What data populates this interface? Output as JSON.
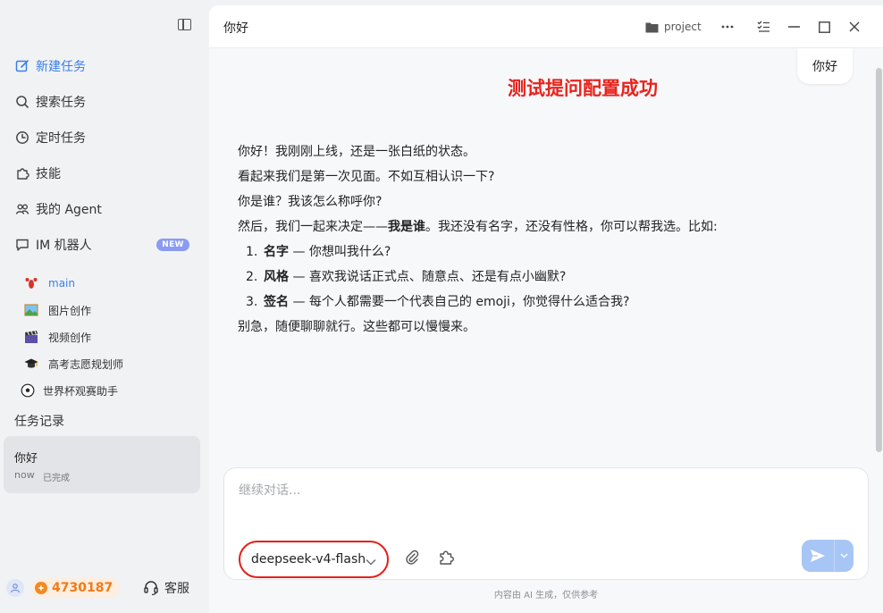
{
  "sidebar": {
    "nav": [
      {
        "label": "新建任务",
        "icon": "new-task-icon",
        "active": true
      },
      {
        "label": "搜索任务",
        "icon": "search-icon"
      },
      {
        "label": "定时任务",
        "icon": "clock-icon"
      },
      {
        "label": "技能",
        "icon": "puzzle-icon"
      },
      {
        "label": "我的 Agent",
        "icon": "agent-icon"
      },
      {
        "label": "IM 机器人",
        "icon": "chat-icon",
        "badge": "NEW"
      }
    ],
    "agents": [
      {
        "label": "main",
        "icon": "lobster-icon"
      },
      {
        "label": "图片创作",
        "icon": "picture-icon"
      },
      {
        "label": "视频创作",
        "icon": "clapper-icon"
      },
      {
        "label": "高考志愿规划师",
        "icon": "graduation-cap-icon"
      },
      {
        "label": "世界杯观赛助手",
        "icon": "soccer-ball-icon"
      }
    ],
    "history_title": "任务记录",
    "task": {
      "title": "你好",
      "time": "now",
      "status": "已完成"
    },
    "points": "4730187",
    "service_label": "客服"
  },
  "main": {
    "title": "你好",
    "project_label": "project",
    "user_message": "你好",
    "overlay_title": "测试提问配置成功",
    "reply": {
      "p1": "你好！我刚刚上线，还是一张白纸的状态。",
      "p2": "看起来我们是第一次见面。不如互相认识一下?",
      "p3": "你是谁？我该怎么称呼你?",
      "p4_prefix": "然后，我们一起来决定——",
      "p4_bold": "我是谁",
      "p4_suffix": "。我还没有名字，还没有性格，你可以帮我选。比如:",
      "list": [
        {
          "num": "1.",
          "bold": "名字",
          "text": " — 你想叫我什么?"
        },
        {
          "num": "2.",
          "bold": "风格",
          "text": " — 喜欢我说话正式点、随意点、还是有点小幽默?"
        },
        {
          "num": "3.",
          "bold": "签名",
          "text": " — 每个人都需要一个代表自己的 emoji，你觉得什么适合我?"
        }
      ],
      "p5": "别急，随便聊聊就行。这些都可以慢慢来。"
    },
    "composer": {
      "placeholder": "继续对话...",
      "model": "deepseek-v4-flash"
    },
    "footnote": "内容由 AI 生成，仅供参考"
  },
  "colors": {
    "accent": "#3a7ee8",
    "highlight_red": "#e3201a",
    "points_orange": "#f07a16"
  }
}
